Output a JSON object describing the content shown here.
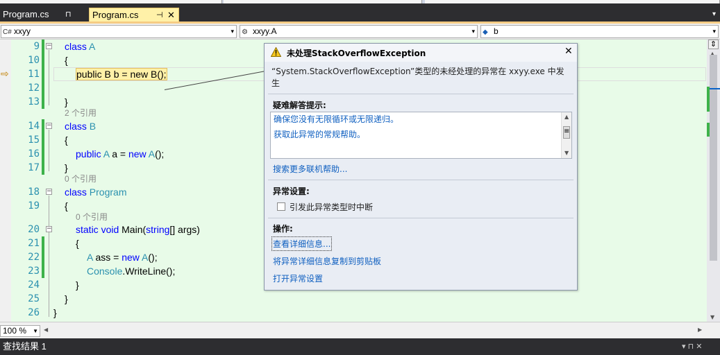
{
  "tabs": [
    {
      "label": "Program.cs",
      "pin": "⊓",
      "active": false
    },
    {
      "label": "Program.cs",
      "pin": "⊣",
      "close": "✕",
      "active": true
    }
  ],
  "tab_dropdown": "▾",
  "nav": {
    "project": "xxyy",
    "type": "xxyy.A",
    "member": "b",
    "dropdown_arrow": "▾"
  },
  "code": {
    "line_numbers": [
      "9",
      "10",
      "11",
      "12",
      "13",
      "14",
      "15",
      "16",
      "17",
      "18",
      "19",
      "20",
      "21",
      "22",
      "23",
      "24",
      "25",
      "26"
    ],
    "lines": {
      "l9_kw": "class",
      "l9_ty": "A",
      "l10": "{",
      "l11": "public B b = new B();",
      "l13": "}",
      "ref1": "2 个引用",
      "l14_kw": "class",
      "l14_ty": "B",
      "l15": "{",
      "l16_kw1": "public",
      "l16_ty": "A",
      "l16_mid": "a =",
      "l16_kw2": "new",
      "l16_ty2": "A",
      "l16_end": "();",
      "l17": "}",
      "ref2": "0 个引用",
      "l18_kw": "class",
      "l18_ty": "Program",
      "l19": "{",
      "ref3": "0 个引用",
      "l20_kw": "static void",
      "l20_mid": "Main(",
      "l20_kw2": "string",
      "l20_end": "[] args)",
      "l21": "{",
      "l22_ty": "A",
      "l22_mid": "ass =",
      "l22_kw": "new",
      "l22_ty2": "A",
      "l22_end": "();",
      "l23_ty": "Console",
      "l23_end": ".WriteLine();",
      "l24": "}",
      "l25": "}",
      "l26": "}"
    }
  },
  "zoom": "100 %",
  "bottom_panel": {
    "title": "查找结果 1",
    "controls": "▾ ⊓ ✕"
  },
  "exception_popup": {
    "title": "未处理StackOverflowException",
    "close": "✕",
    "message": "“System.StackOverflowException”类型的未经处理的异常在 xxyy.exe 中发生",
    "tips_heading": "疑难解答提示:",
    "tips": [
      "确保您没有无限循环或无限递归。",
      "获取此异常的常规帮助。"
    ],
    "search_link": "搜索更多联机帮助...",
    "settings_heading": "异常设置:",
    "break_checkbox_label": "引发此异常类型时中断",
    "break_checked": false,
    "actions_heading": "操作:",
    "actions": [
      "查看详细信息...",
      "将异常详细信息复制到剪贴板",
      "打开异常设置"
    ]
  },
  "colors": {
    "editor_bg": "#e8fbe8",
    "keyword": "#0000ff",
    "type": "#2b91af",
    "active_tab": "#fff1a8",
    "change_bar": "#3db24a"
  },
  "icons": [
    "warning-icon",
    "close-icon",
    "pin-icon",
    "csharp-project-icon",
    "class-icon",
    "field-icon",
    "breakpoint-arrow-icon",
    "dropdown-arrow-icon",
    "split-icon"
  ]
}
